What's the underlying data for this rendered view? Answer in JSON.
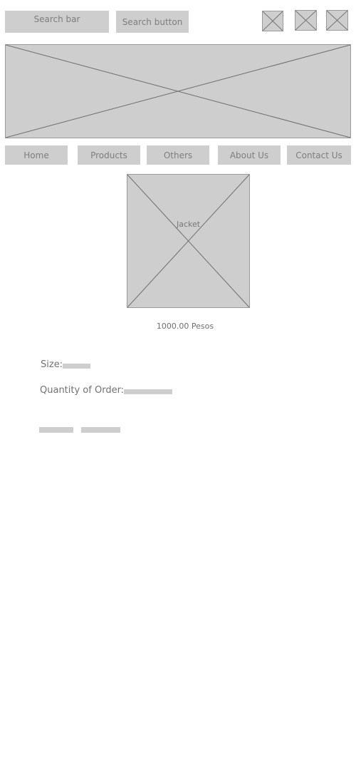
{
  "header": {
    "search_bar_label": "Search bar",
    "search_button_label": "Search button"
  },
  "nav": {
    "items": [
      {
        "label": "Home"
      },
      {
        "label": "Products"
      },
      {
        "label": "Others"
      },
      {
        "label": "About Us"
      },
      {
        "label": "Contact Us"
      }
    ]
  },
  "product": {
    "image_label": "Jacket",
    "price": "1000.00 Pesos"
  },
  "form": {
    "size_label": "Size:",
    "quantity_label": "Quantity of Order:"
  },
  "icons": {
    "placeholder": "image-placeholder-icon"
  },
  "colors": {
    "placeholder_fill": "#cecece",
    "text": "#7a7a7a"
  }
}
